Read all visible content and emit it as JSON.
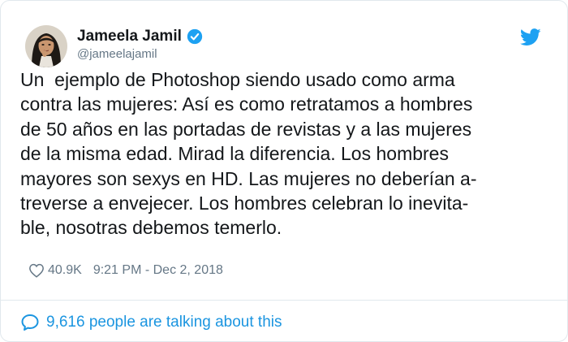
{
  "user": {
    "name": "Jameela Jamil",
    "handle": "@jameelajamil",
    "verified": true
  },
  "tweet": {
    "lines": [
      "Un  ejemplo de Photoshop siendo usado como arma",
      "contra las mujeres: Así es como retratamos a hombres",
      "de 50 años en las portadas de revistas y a las mujeres",
      "de la misma edad. Mirad la diferencia. Los hombres",
      "mayores son sexys en HD. Las mujeres no deberían a-",
      "treverse a envejecer. Los hombres celebran lo inevita-",
      "ble, nosotras debemos temerlo."
    ],
    "likes": "40.9K",
    "timestamp": "9:21 PM - Dec 2, 2018"
  },
  "footer": {
    "talking_text": "9,616 people are talking about this"
  },
  "icons": {
    "verified": "verified-badge-icon",
    "brand": "twitter-bird-icon",
    "like": "heart-icon",
    "talk": "speech-bubble-icon"
  },
  "colors": {
    "accent": "#1da1f2",
    "link": "#1b95e0",
    "muted": "#657786",
    "text": "#14171a",
    "border": "#e1e8ed"
  }
}
